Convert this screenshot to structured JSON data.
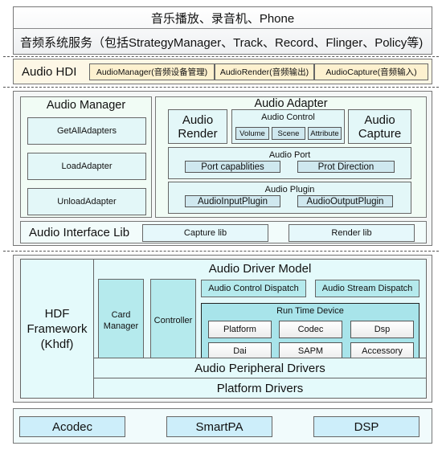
{
  "app_layer": {
    "apps": "音乐播放、录音机、Phone",
    "services": "音频系统服务（包括StrategyManager、Track、Record、Flinger、Policy等)"
  },
  "hdi": {
    "title": "Audio HDI",
    "items": [
      "AudioManager(音频设备管理)",
      "AudioRender(音频输出)",
      "AudioCapture(音频输入)"
    ]
  },
  "audio_manager": {
    "title": "Audio Manager",
    "items": [
      "GetAllAdapters",
      "LoadAdapter",
      "UnloadAdapter"
    ]
  },
  "audio_adapter": {
    "title": "Audio Adapter",
    "render": "Audio Render",
    "capture": "Audio Capture",
    "control": {
      "title": "Audio Control",
      "items": [
        "Volume",
        "Scene",
        "Attribute"
      ]
    },
    "port": {
      "title": "Audio Port",
      "items": [
        "Port capablities",
        "Prot Direction"
      ]
    },
    "plugin": {
      "title": "Audio Plugin",
      "items": [
        "AudioInputPlugin",
        "AudioOutputPlugin"
      ]
    }
  },
  "interface_lib": {
    "title": "Audio Interface Lib",
    "items": [
      "Capture lib",
      "Render lib"
    ]
  },
  "hdf": {
    "title": "HDF Framework (Khdf)"
  },
  "driver_model": {
    "title": "Audio Driver Model",
    "card_manager": "Card Manager",
    "controller": "Controller",
    "dispatch": [
      "Audio Control Dispatch",
      "Audio Stream Dispatch"
    ],
    "runtime": {
      "title": "Run Time Device",
      "items": [
        "Platform",
        "Codec",
        "Dsp",
        "Dai",
        "SAPM",
        "Accessory"
      ]
    },
    "peripheral": "Audio Peripheral Drivers",
    "platform": "Platform Drivers"
  },
  "hardware": {
    "items": [
      "Acodec",
      "SmartPA",
      "DSP"
    ]
  },
  "colors": {
    "hdi_bg": "#fdf7e6",
    "hdi_box": "#fdf1cf",
    "panel_bg": "#f1fcf5",
    "box_bg": "#e3f7f8",
    "button_bg": "#cfe8ef",
    "driver_bg": "#e4fafb",
    "driver_accent": "#b5eaed",
    "runtime_bg": "#a8e4ea",
    "hardware_box": "#cdeefa"
  }
}
